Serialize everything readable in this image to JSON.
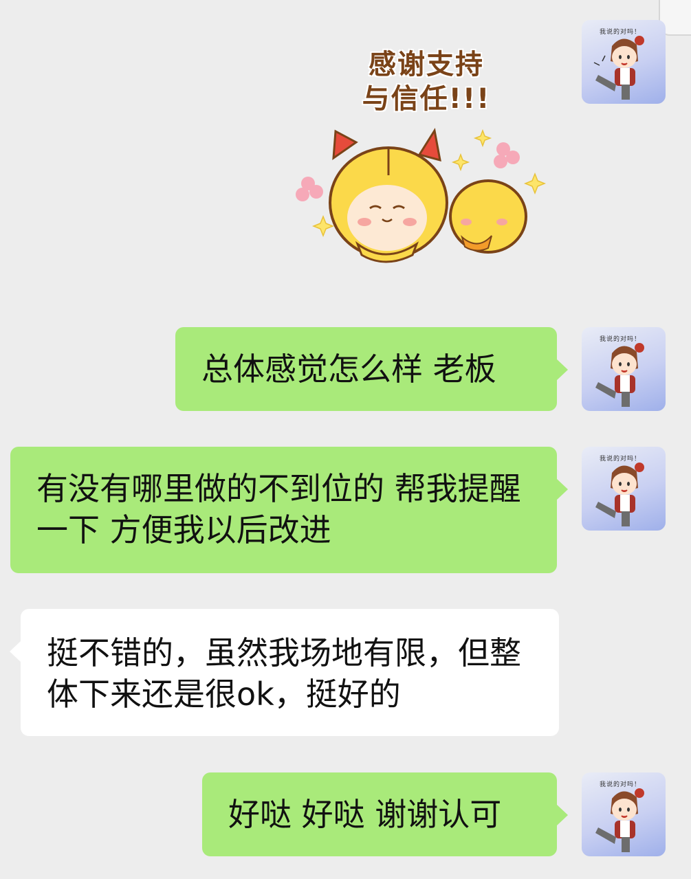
{
  "sticker": {
    "text": "感谢支持\n与信任!!!",
    "line1": "感谢支持",
    "line2": "与信任!!!"
  },
  "avatar": {
    "caption": "我说的对吗！",
    "colors": {
      "background_top": "#e9ecf6",
      "background_bottom": "#9fb0ea"
    }
  },
  "messages": [
    {
      "sender": "self",
      "text": "总体感觉怎么样 老板"
    },
    {
      "sender": "self",
      "text": "有没有哪里做的不到位的 帮我提醒一下 方便我以后改进"
    },
    {
      "sender": "other",
      "text": "挺不错的，虽然我场地有限，但整体下来还是很ok，挺好的"
    },
    {
      "sender": "self",
      "text": "好哒 好哒 谢谢认可"
    }
  ],
  "colors": {
    "chat_background": "#ededed",
    "self_bubble": "#a9ea7a",
    "other_bubble": "#ffffff"
  }
}
